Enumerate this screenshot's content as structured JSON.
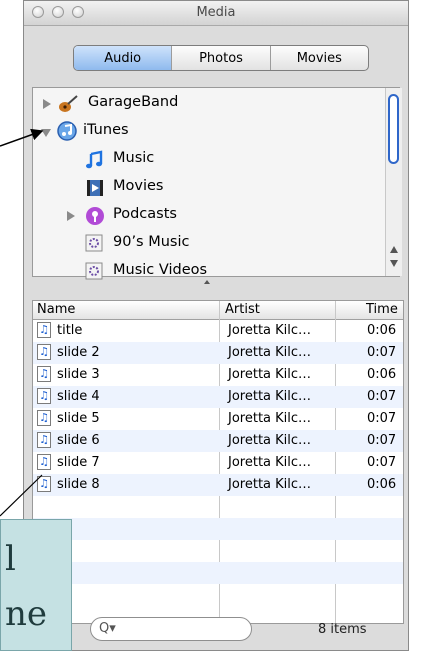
{
  "window": {
    "title": "Media"
  },
  "tabs": [
    {
      "label": "Audio",
      "selected": true
    },
    {
      "label": "Photos",
      "selected": false
    },
    {
      "label": "Movies",
      "selected": false
    }
  ],
  "source_tree": {
    "items": [
      {
        "label": "GarageBand",
        "icon": "guitar-icon",
        "disclosure": "collapsed",
        "level": 0
      },
      {
        "label": "iTunes",
        "icon": "itunes-icon",
        "disclosure": "expanded",
        "level": 0
      },
      {
        "label": "Music",
        "icon": "music-note-icon",
        "disclosure": "none",
        "level": 1
      },
      {
        "label": "Movies",
        "icon": "film-icon",
        "disclosure": "none",
        "level": 1
      },
      {
        "label": "Podcasts",
        "icon": "podcast-icon",
        "disclosure": "collapsed",
        "level": 1
      },
      {
        "label": "90’s Music",
        "icon": "smart-playlist-icon",
        "disclosure": "none",
        "level": 1
      },
      {
        "label": "Music Videos",
        "icon": "smart-playlist-icon",
        "disclosure": "none",
        "level": 1
      }
    ]
  },
  "list": {
    "columns": [
      "Name",
      "Artist",
      "Time"
    ],
    "rows": [
      {
        "name": "title",
        "artist": "Joretta Kilc…",
        "time": "0:06"
      },
      {
        "name": "slide 2",
        "artist": "Joretta Kilc…",
        "time": "0:07"
      },
      {
        "name": "slide 3",
        "artist": "Joretta Kilc…",
        "time": "0:06"
      },
      {
        "name": "slide 4",
        "artist": "Joretta Kilc…",
        "time": "0:07"
      },
      {
        "name": "slide 5",
        "artist": "Joretta Kilc…",
        "time": "0:07"
      },
      {
        "name": "slide 6",
        "artist": "Joretta Kilc…",
        "time": "0:07"
      },
      {
        "name": "slide 7",
        "artist": "Joretta Kilc…",
        "time": "0:07"
      },
      {
        "name": "slide 8",
        "artist": "Joretta Kilc…",
        "time": "0:06"
      }
    ]
  },
  "footer": {
    "search_placeholder": "Q▾",
    "item_count": "8 items"
  },
  "callout": {
    "text": "l\nne"
  },
  "colors": {
    "selected_tab": "#8fbaee",
    "scroll_thumb": "#2e66c9",
    "row_alt": "#edf3fe",
    "callout_bg": "#c5e1e3"
  }
}
